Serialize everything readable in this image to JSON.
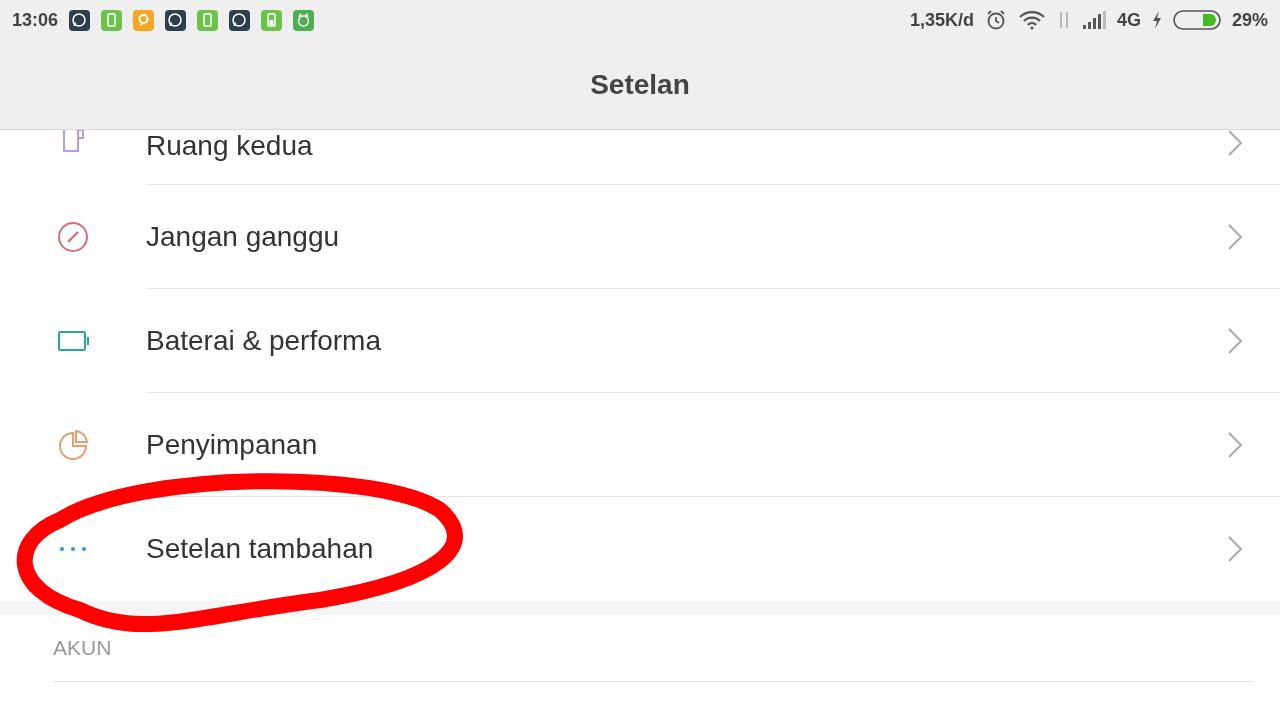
{
  "status_bar": {
    "time": "13:06",
    "network_speed": "1,35K/d",
    "network_type": "4G",
    "battery": "29%"
  },
  "header": {
    "title": "Setelan"
  },
  "items": [
    {
      "label": "Ruang kedua"
    },
    {
      "label": "Jangan ganggu"
    },
    {
      "label": "Baterai & performa"
    },
    {
      "label": "Penyimpanan"
    },
    {
      "label": "Setelan tambahan"
    }
  ],
  "section": {
    "title": "AKUN"
  }
}
